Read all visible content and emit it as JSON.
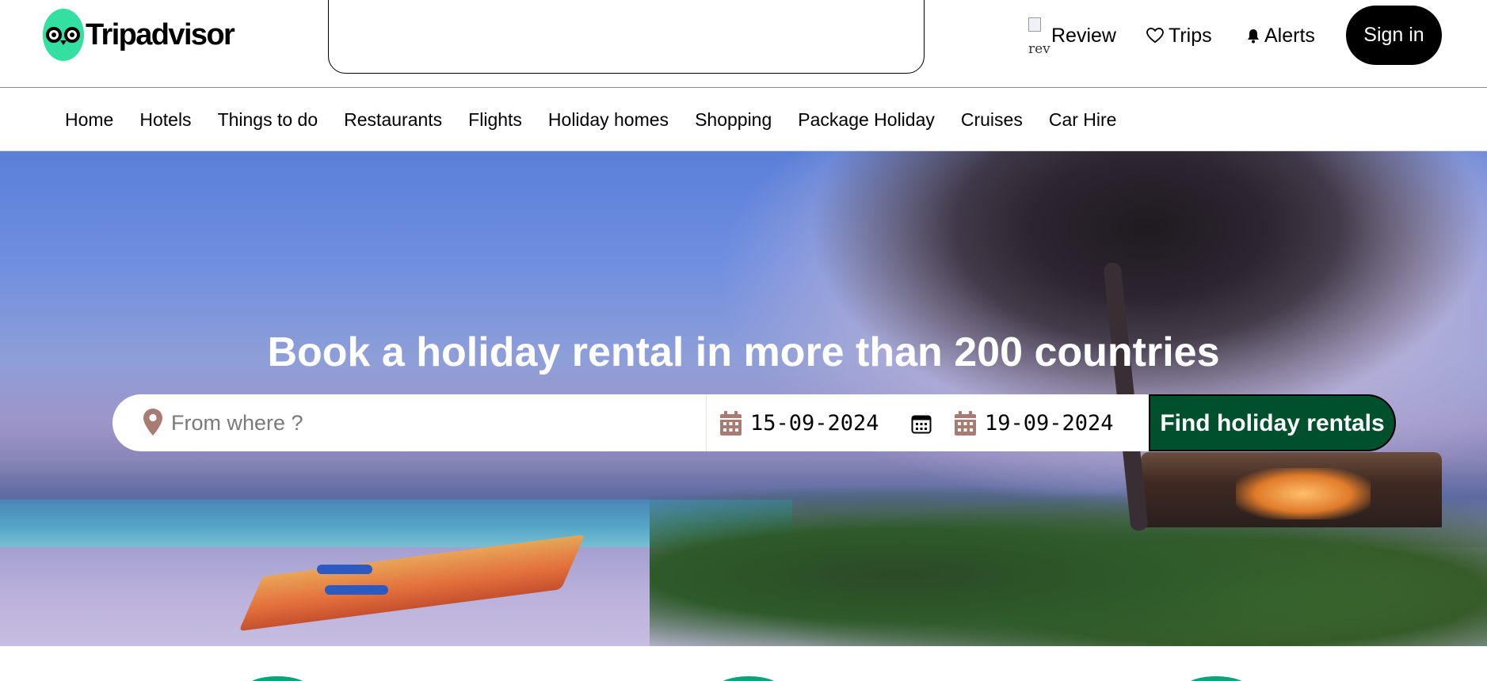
{
  "header": {
    "logo_text": "Tripadvisor",
    "search_placeholder": "",
    "review_img_alt": "rev",
    "review_label": "Review",
    "trips_label": "Trips",
    "alerts_label": "Alerts",
    "signin_label": "Sign in"
  },
  "nav": {
    "items": [
      "Home",
      "Hotels",
      "Things to do",
      "Restaurants",
      "Flights",
      "Holiday homes",
      "Shopping",
      "Package Holiday",
      "Cruises",
      "Car Hire"
    ]
  },
  "hero": {
    "title": "Book a holiday rental in more than 200 countries",
    "where_placeholder": "From where ?",
    "check_in": "15-09-2024",
    "check_out": "19-09-2024",
    "find_button": "Find holiday rentals"
  },
  "colors": {
    "brand_green": "#34e0a1",
    "button_dark_green": "#00502e",
    "signin_bg": "#000000",
    "date_icon": "#a87b73"
  },
  "icons": [
    "owl-logo-icon",
    "heart-icon",
    "bell-icon",
    "location-pin-icon",
    "calendar-icon",
    "calendar-picker-icon"
  ]
}
